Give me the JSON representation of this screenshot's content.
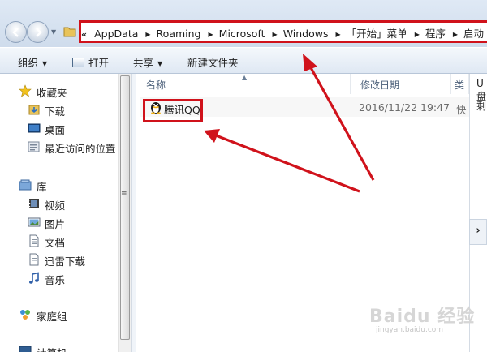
{
  "address_bar": {
    "overflow_glyph": "«",
    "crumbs": [
      "AppData",
      "Roaming",
      "Microsoft",
      "Windows",
      "「开始」菜单",
      "程序",
      "启动"
    ]
  },
  "toolbar": {
    "organize": "组织",
    "open": "打开",
    "share": "共享",
    "new_folder": "新建文件夹"
  },
  "nav_pane": {
    "favorites": "收藏夹",
    "downloads": "下载",
    "desktop": "桌面",
    "recent": "最近访问的位置",
    "libraries": "库",
    "videos": "视频",
    "pictures": "图片",
    "documents": "文档",
    "xunlei": "迅雷下载",
    "music": "音乐",
    "homegroup": "家庭组",
    "computer": "计算机"
  },
  "file_list": {
    "columns": {
      "name": "名称",
      "date": "修改日期",
      "type": "类"
    },
    "rows": [
      {
        "name": "腾讯QQ",
        "date": "2016/11/22 19:47",
        "type": "快"
      }
    ]
  },
  "right_panel": {
    "line1": "U盘",
    "line2": "剩"
  },
  "watermark": {
    "brand": "Baidu 经验",
    "url": "jingyan.baidu.com"
  },
  "colors": {
    "annotation_red": "#d0121b",
    "toolbar_bg": "#dfe8f3"
  }
}
